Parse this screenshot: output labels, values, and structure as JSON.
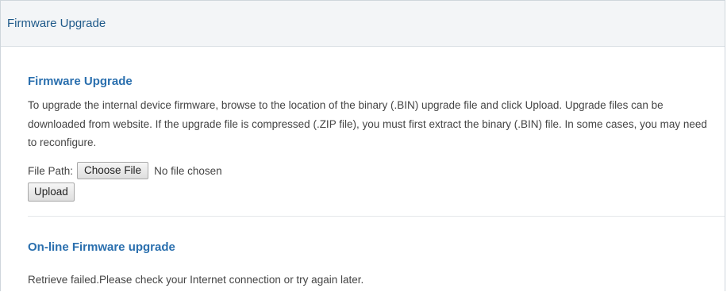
{
  "panel": {
    "title": "Firmware Upgrade"
  },
  "firmware_upgrade": {
    "heading": "Firmware Upgrade",
    "description": "To upgrade the internal device firmware, browse to the location of the binary (.BIN) upgrade file and click Upload. Upgrade files can be downloaded from website. If the upgrade file is compressed (.ZIP file), you must first extract the binary (.BIN) file. In some cases, you may need to reconfigure.",
    "file_path_label": "File Path:",
    "choose_file_label": "Choose File",
    "no_file_text": "No file chosen",
    "upload_label": "Upload"
  },
  "online_upgrade": {
    "heading": "On-line Firmware upgrade",
    "status": "Retrieve failed.Please check your Internet connection or try again later."
  }
}
